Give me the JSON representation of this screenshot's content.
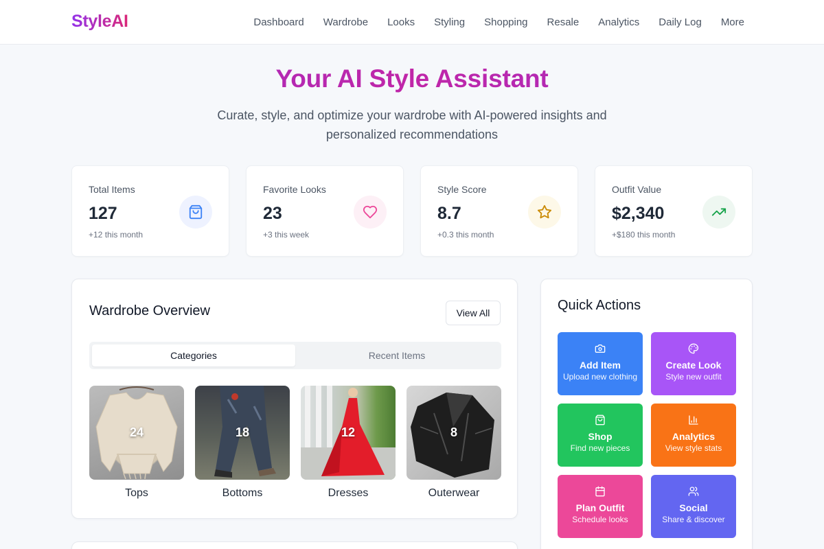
{
  "app": {
    "logo": "StyleAI"
  },
  "nav": {
    "links": [
      "Dashboard",
      "Wardrobe",
      "Looks",
      "Styling",
      "Shopping",
      "Resale",
      "Analytics",
      "Daily Log",
      "More"
    ]
  },
  "hero": {
    "title": "Your AI Style Assistant",
    "subtitle": "Curate, style, and optimize your wardrobe with AI-powered insights and personalized recommendations"
  },
  "stats": [
    {
      "label": "Total Items",
      "value": "127",
      "change": "+12 this month",
      "icon": "shopping-bag-icon",
      "color": "#3b82f6",
      "bg": "#eef2ff"
    },
    {
      "label": "Favorite Looks",
      "value": "23",
      "change": "+3 this week",
      "icon": "heart-icon",
      "color": "#ec4899",
      "bg": "#fdf0f6"
    },
    {
      "label": "Style Score",
      "value": "8.7",
      "change": "+0.3 this month",
      "icon": "star-icon",
      "color": "#ca8a04",
      "bg": "#fdf8e8"
    },
    {
      "label": "Outfit Value",
      "value": "$2,340",
      "change": "+$180 this month",
      "icon": "trending-up-icon",
      "color": "#16a34a",
      "bg": "#eef7f1"
    }
  ],
  "wardrobe": {
    "title": "Wardrobe Overview",
    "view_all": "View All",
    "tabs": [
      {
        "label": "Categories",
        "active": true
      },
      {
        "label": "Recent Items",
        "active": false
      }
    ],
    "categories": [
      {
        "name": "Tops",
        "count": "24"
      },
      {
        "name": "Bottoms",
        "count": "18"
      },
      {
        "name": "Dresses",
        "count": "12"
      },
      {
        "name": "Outerwear",
        "count": "8"
      }
    ]
  },
  "quick_actions": {
    "title": "Quick Actions",
    "items": [
      {
        "title": "Add Item",
        "sub": "Upload new clothing",
        "icon": "camera-icon",
        "color": "#3b82f6"
      },
      {
        "title": "Create Look",
        "sub": "Style new outfit",
        "icon": "palette-icon",
        "color": "#a855f7"
      },
      {
        "title": "Shop",
        "sub": "Find new pieces",
        "icon": "shopping-bag-icon",
        "color": "#22c55e"
      },
      {
        "title": "Analytics",
        "sub": "View style stats",
        "icon": "bar-chart-icon",
        "color": "#f97316"
      },
      {
        "title": "Plan Outfit",
        "sub": "Schedule looks",
        "icon": "calendar-icon",
        "color": "#ec4899"
      },
      {
        "title": "Social",
        "sub": "Share & discover",
        "icon": "users-icon",
        "color": "#6366f1"
      }
    ]
  }
}
